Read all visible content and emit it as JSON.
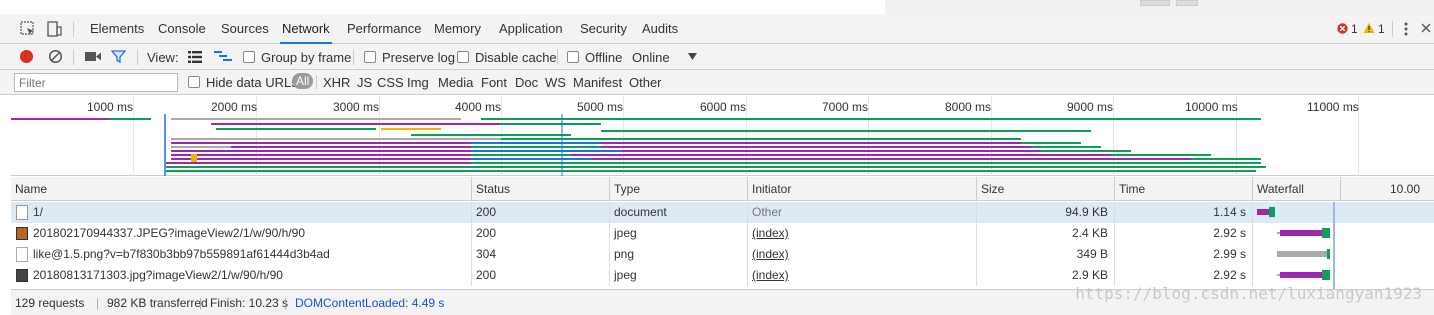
{
  "tabs": [
    "Elements",
    "Console",
    "Sources",
    "Network",
    "Performance",
    "Memory",
    "Application",
    "Security",
    "Audits"
  ],
  "active_tab": "Network",
  "counts": {
    "errors": "1",
    "warnings": "1"
  },
  "toolbar": {
    "view_label": "View:",
    "group_by_frame": "Group by frame",
    "preserve_log": "Preserve log",
    "disable_cache": "Disable cache",
    "offline": "Offline",
    "throttle": "Online"
  },
  "filterbar": {
    "filter_placeholder": "Filter",
    "hide_data_urls": "Hide data URLs",
    "types": [
      "All",
      "XHR",
      "JS",
      "CSS",
      "Img",
      "Media",
      "Font",
      "Doc",
      "WS",
      "Manifest",
      "Other"
    ],
    "active_type": "All"
  },
  "overview": {
    "ticks": [
      "1000 ms",
      "2000 ms",
      "3000 ms",
      "4000 ms",
      "5000 ms",
      "6000 ms",
      "7000 ms",
      "8000 ms",
      "9000 ms",
      "10000 ms",
      "11000 ms"
    ]
  },
  "table": {
    "headers": [
      "Name",
      "Status",
      "Type",
      "Initiator",
      "Size",
      "Time",
      "Waterfall"
    ],
    "waterfall_scale": "10.00",
    "rows": [
      {
        "name": "1/",
        "status": "200",
        "type": "document",
        "initiator": "Other",
        "size": "94.9 KB",
        "time": "1.14 s"
      },
      {
        "name": "201802170944337.JPEG?imageView2/1/w/90/h/90",
        "status": "200",
        "type": "jpeg",
        "initiator": "(index)",
        "size": "2.4 KB",
        "time": "2.92 s"
      },
      {
        "name": "like@1.5.png?v=b7f830b3bb97b559891af61444d3b4ad",
        "status": "304",
        "type": "png",
        "initiator": "(index)",
        "size": "349 B",
        "time": "2.99 s"
      },
      {
        "name": "20180813171303.jpg?imageView2/1/w/90/h/90",
        "status": "200",
        "type": "jpeg",
        "initiator": "(index)",
        "size": "2.9 KB",
        "time": "2.92 s"
      }
    ]
  },
  "statusbar": {
    "requests": "129 requests",
    "transferred": "982 KB transferred",
    "finish": "Finish: 10.23 s",
    "dom_loaded": "DOMContentLoaded: 4.49 s"
  },
  "watermark": "https://blog.csdn.net/luxiangyan1923",
  "colors": {
    "purple": "#9c27b0",
    "green": "#0f9d58",
    "blue": "#1a73e8",
    "gray": "#aaaaaa",
    "selected_row": "#dee9f6"
  }
}
